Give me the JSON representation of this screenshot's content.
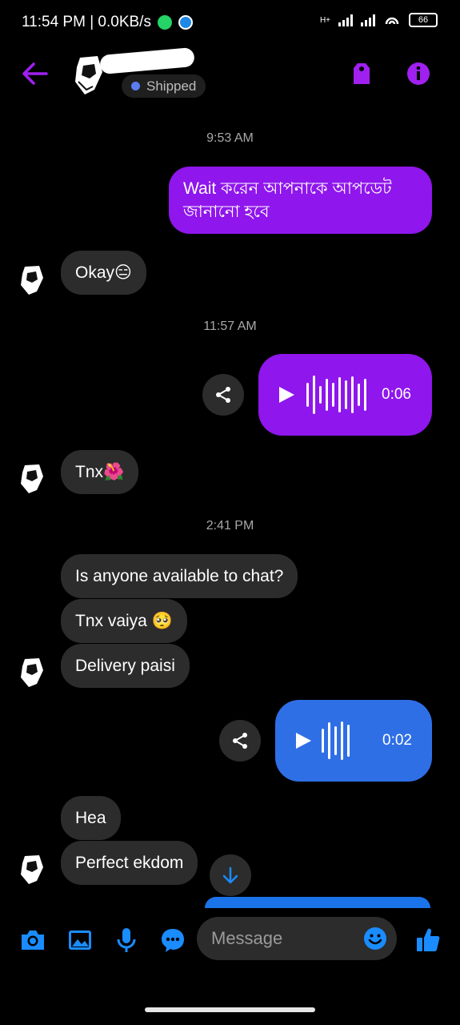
{
  "status_bar": {
    "time_speed": "11:54 PM | 0.0KB/s",
    "network_label": "H+",
    "battery": "66"
  },
  "header": {
    "contact_status": "Shipped"
  },
  "messages": {
    "time_1": "9:53 AM",
    "out_1": "Wait করেন আপনাকে আপডেট জানানো হবে",
    "in_1": "Okay😑",
    "time_2": "11:57 AM",
    "voice_1_duration": "0:06",
    "in_2": "Tnx🌺",
    "time_3": "2:41 PM",
    "in_3": "Is anyone available to chat?",
    "in_4": "Tnx vaiya 🥺",
    "in_5": "Delivery paisi",
    "voice_2_duration": "0:02",
    "in_6": "Hea",
    "in_7": "Perfect ekdom"
  },
  "composer": {
    "placeholder": "Message"
  },
  "colors": {
    "accent_purple": "#8f16ec",
    "outgoing_blue": "#2f6fe6",
    "icon_blue": "#1a8cff"
  }
}
